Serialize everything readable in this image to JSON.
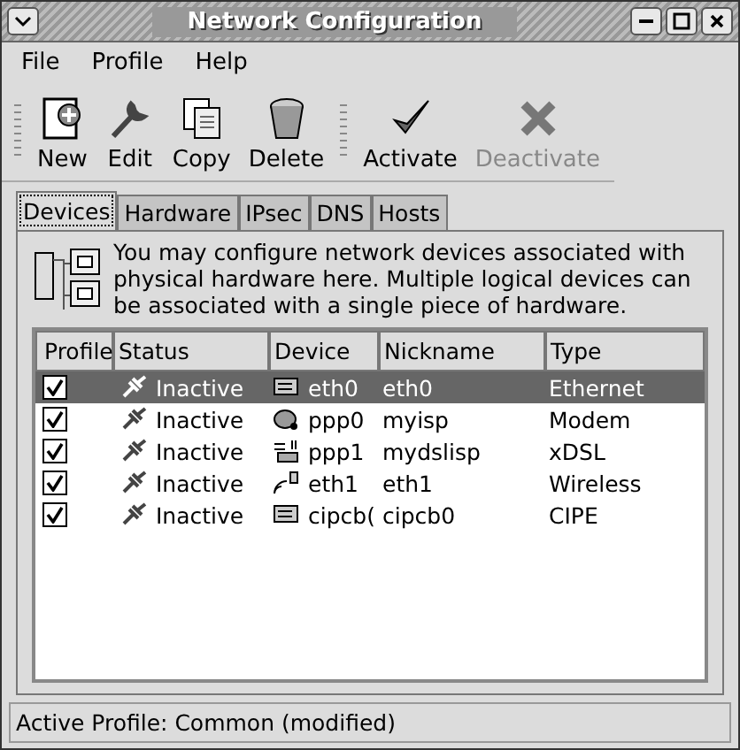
{
  "window": {
    "title": "Network Configuration"
  },
  "menu": [
    "File",
    "Profile",
    "Help"
  ],
  "toolbar": [
    {
      "label": "New",
      "kind": "new",
      "disabled": false
    },
    {
      "label": "Edit",
      "kind": "edit",
      "disabled": false
    },
    {
      "label": "Copy",
      "kind": "copy",
      "disabled": false
    },
    {
      "label": "Delete",
      "kind": "delete",
      "disabled": false
    },
    {
      "label": "Activate",
      "kind": "activate",
      "disabled": false
    },
    {
      "label": "Deactivate",
      "kind": "deactivate",
      "disabled": true
    }
  ],
  "tabs": [
    {
      "label": "Devices",
      "selected": true
    },
    {
      "label": "Hardware",
      "selected": false
    },
    {
      "label": "IPsec",
      "selected": false
    },
    {
      "label": "DNS",
      "selected": false
    },
    {
      "label": "Hosts",
      "selected": false
    }
  ],
  "description": "You may configure network devices associated with physical hardware here.  Multiple logical devices can be associated with a single piece of hardware.",
  "table": {
    "columns": [
      "Profile",
      "Status",
      "Device",
      "Nickname",
      "Type"
    ],
    "rows": [
      {
        "checked": true,
        "status": "Inactive",
        "device": "eth0",
        "kind": "ethernet",
        "nickname": "eth0",
        "type": "Ethernet",
        "selected": true
      },
      {
        "checked": true,
        "status": "Inactive",
        "device": "ppp0",
        "kind": "modem",
        "nickname": "myisp",
        "type": "Modem",
        "selected": false
      },
      {
        "checked": true,
        "status": "Inactive",
        "device": "ppp1",
        "kind": "dsl",
        "nickname": "mydslisp",
        "type": "xDSL",
        "selected": false
      },
      {
        "checked": true,
        "status": "Inactive",
        "device": "eth1",
        "kind": "wireless",
        "nickname": "eth1",
        "type": "Wireless",
        "selected": false
      },
      {
        "checked": true,
        "status": "Inactive",
        "device": "cipcb(",
        "kind": "cipe",
        "nickname": "cipcb0",
        "type": "CIPE",
        "selected": false
      }
    ]
  },
  "status_bar": "Active Profile: Common (modified)"
}
